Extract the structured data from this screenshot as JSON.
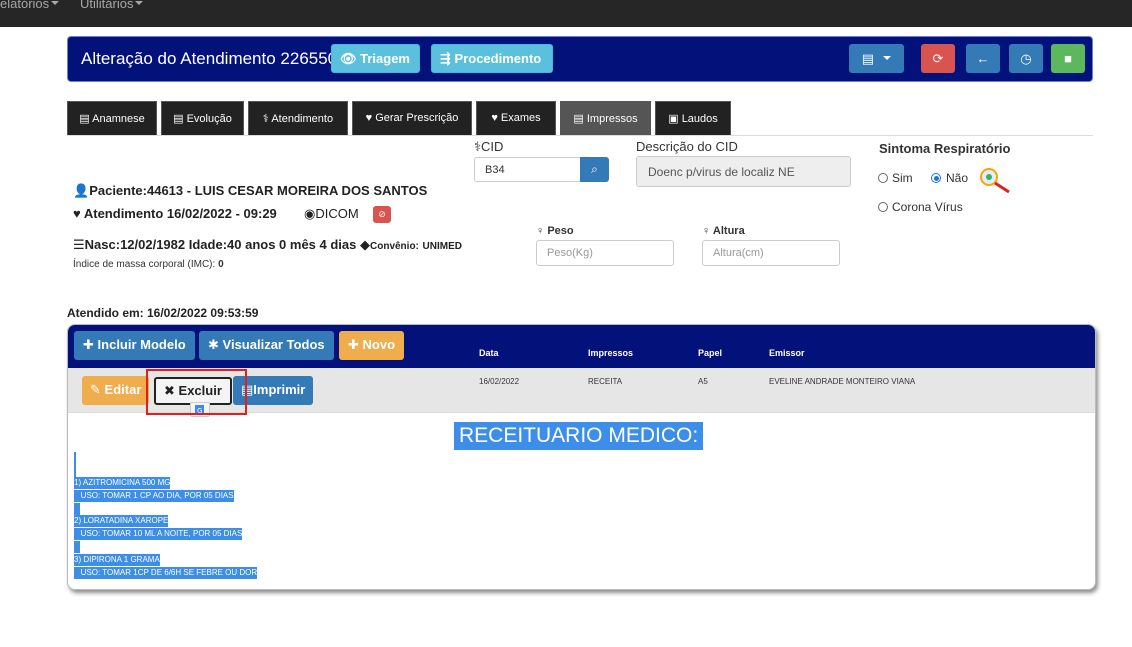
{
  "topnav": {
    "items": [
      "elatórios",
      "Utilitários"
    ]
  },
  "header": {
    "title": "Alteração do Atendimento 226550",
    "triagem_label": "Triagem",
    "procedimento_label": "Procedimento",
    "colors": {
      "bar": "#03127a",
      "info": "#5bc0de",
      "primary": "#337ab7",
      "danger": "#d9534f",
      "success": "#5cb85c"
    }
  },
  "tabs": [
    "Anamnese",
    "Evolução",
    "Atendimento",
    "Gerar Prescrição",
    "Exames",
    "Impressos",
    "Laudos"
  ],
  "active_tab": "Impressos",
  "cid": {
    "label": "CID",
    "value": "B34",
    "desc_label": "Descrição do CID",
    "desc_value": "Doenc p/virus de localiz NE"
  },
  "sintoma": {
    "label": "Sintoma Respiratório",
    "sim": "Sim",
    "nao": "Não",
    "selected": "Não",
    "corona": "Corona Vírus"
  },
  "patient": {
    "paciente": "Paciente:44613 - LUIS CESAR MOREIRA DOS SANTOS",
    "atendimento": "Atendimento 16/02/2022 - 09:29",
    "dicom": "DICOM",
    "nasc": "Nasc:12/02/1982 Idade:40 anos 0 mês 4 dias",
    "convenio_label": "Convênio:",
    "convenio": "UNIMED",
    "imc_label": "Índice de massa corporal (IMC):",
    "imc_value": "0",
    "atendido_em": "Atendido em: 16/02/2022 09:53:59"
  },
  "peso": {
    "label": "Peso",
    "placeholder": "Peso(Kg)"
  },
  "altura": {
    "label": "Altura",
    "placeholder": "Altura(cm)"
  },
  "panel": {
    "incluir_modelo": "Incluir Modelo",
    "visualizar_todos": "Visualizar Todos",
    "novo": "Novo",
    "headers": [
      "Data",
      "Impressos",
      "Papel",
      "Emissor"
    ],
    "row": {
      "data": "16/02/2022",
      "impressos": "RECEITA",
      "papel": "A5",
      "emissor": "EVELINE ANDRADE MONTEIRO VIANA"
    },
    "editar": "Editar",
    "excluir": "Excluir",
    "imprimir": "Imprimir"
  },
  "receituario": {
    "title": "RECEITUARIO MEDICO:",
    "items": [
      {
        "name": "1) AZITROMICINA 500 MG",
        "uso": "   USO: TOMAR 1 CP AO DIA, POR 05 DIAS"
      },
      {
        "name": "2) LORATADINA XAROPE",
        "uso": "   USO: TOMAR 10 ML A NOITE, POR 05 DIAS"
      },
      {
        "name": "3) DIPIRONA 1 GRAMA",
        "uso": "   USO: TOMAR 1CP DE 6/6H SE FEBRE OU DOR"
      }
    ]
  }
}
